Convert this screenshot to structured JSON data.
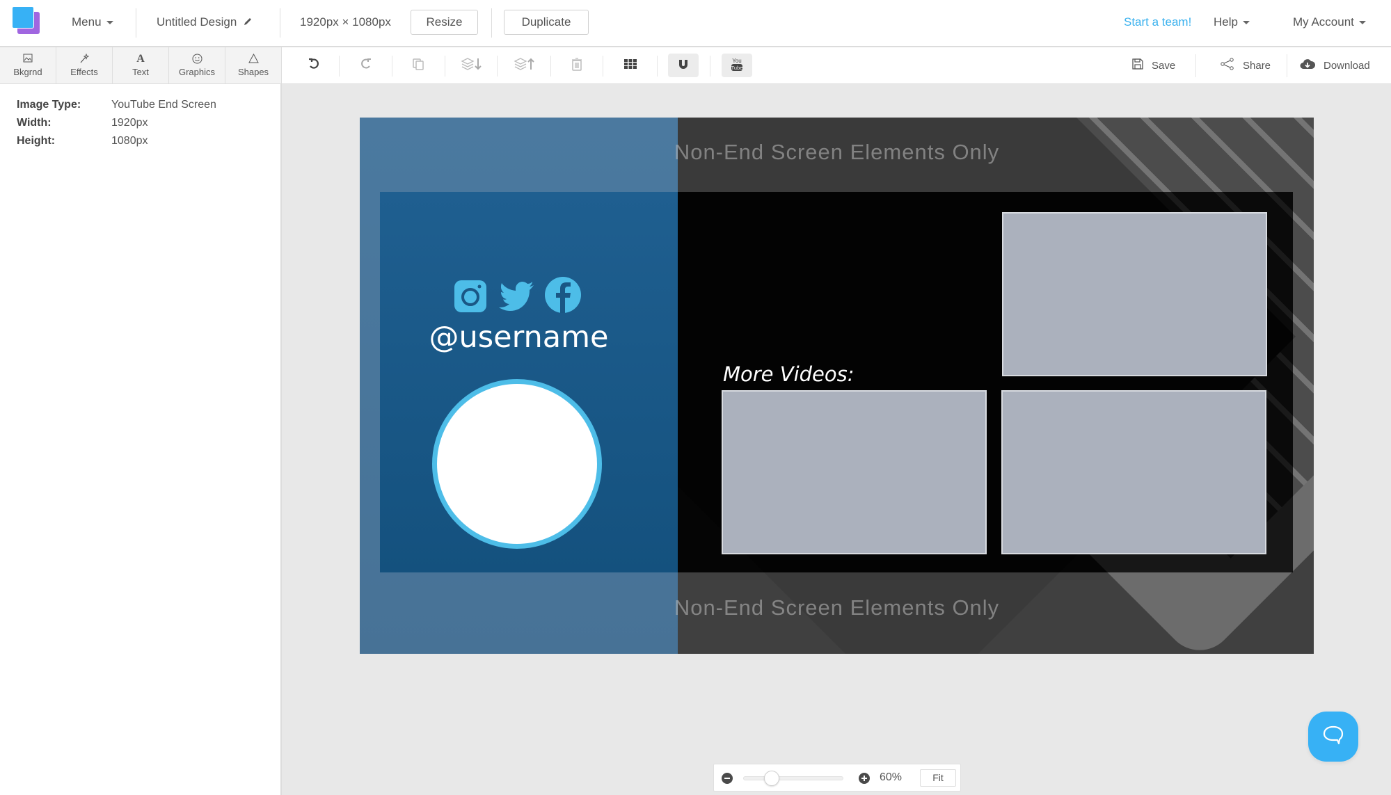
{
  "header": {
    "menu_label": "Menu",
    "design_title": "Untitled Design",
    "dimensions": "1920px × 1080px",
    "resize_label": "Resize",
    "duplicate_label": "Duplicate",
    "start_team_label": "Start a team!",
    "help_label": "Help",
    "account_label": "My Account"
  },
  "tabs": [
    {
      "label": "Bkgrnd",
      "icon": "image-icon"
    },
    {
      "label": "Effects",
      "icon": "magic-wand-icon"
    },
    {
      "label": "Text",
      "icon": "text-icon"
    },
    {
      "label": "Graphics",
      "icon": "smiley-icon"
    },
    {
      "label": "Shapes",
      "icon": "triangle-icon"
    }
  ],
  "toolbar": {
    "tools": [
      "undo-icon",
      "redo-icon",
      "copy-icon",
      "layer-down-icon",
      "layer-up-icon",
      "trash-icon",
      "grid-icon",
      "magnet-icon",
      "youtube-icon"
    ],
    "save_label": "Save",
    "share_label": "Share",
    "download_label": "Download"
  },
  "properties": {
    "rows": [
      {
        "key": "Image Type:",
        "value": "YouTube End Screen"
      },
      {
        "key": "Width:",
        "value": "1920px"
      },
      {
        "key": "Height:",
        "value": "1080px"
      }
    ]
  },
  "canvas": {
    "safe_area_label_top": "Non-End Screen Elements Only",
    "safe_area_label_bottom": "Non-End Screen Elements Only",
    "username": "@username",
    "more_videos": "More Videos:",
    "social_icons": [
      "instagram-icon",
      "twitter-icon",
      "facebook-icon"
    ],
    "colors": {
      "accent_blue": "#4dbde8",
      "panel_blue": "#1a5785",
      "video_placeholder": "#abb1bd"
    }
  },
  "zoom": {
    "value_label": "60%",
    "slider_fraction": 0.28,
    "fit_label": "Fit"
  },
  "colors": {
    "brand": "#37b1f5",
    "brand_secondary": "#a066e0",
    "link": "#3ab1ee"
  }
}
